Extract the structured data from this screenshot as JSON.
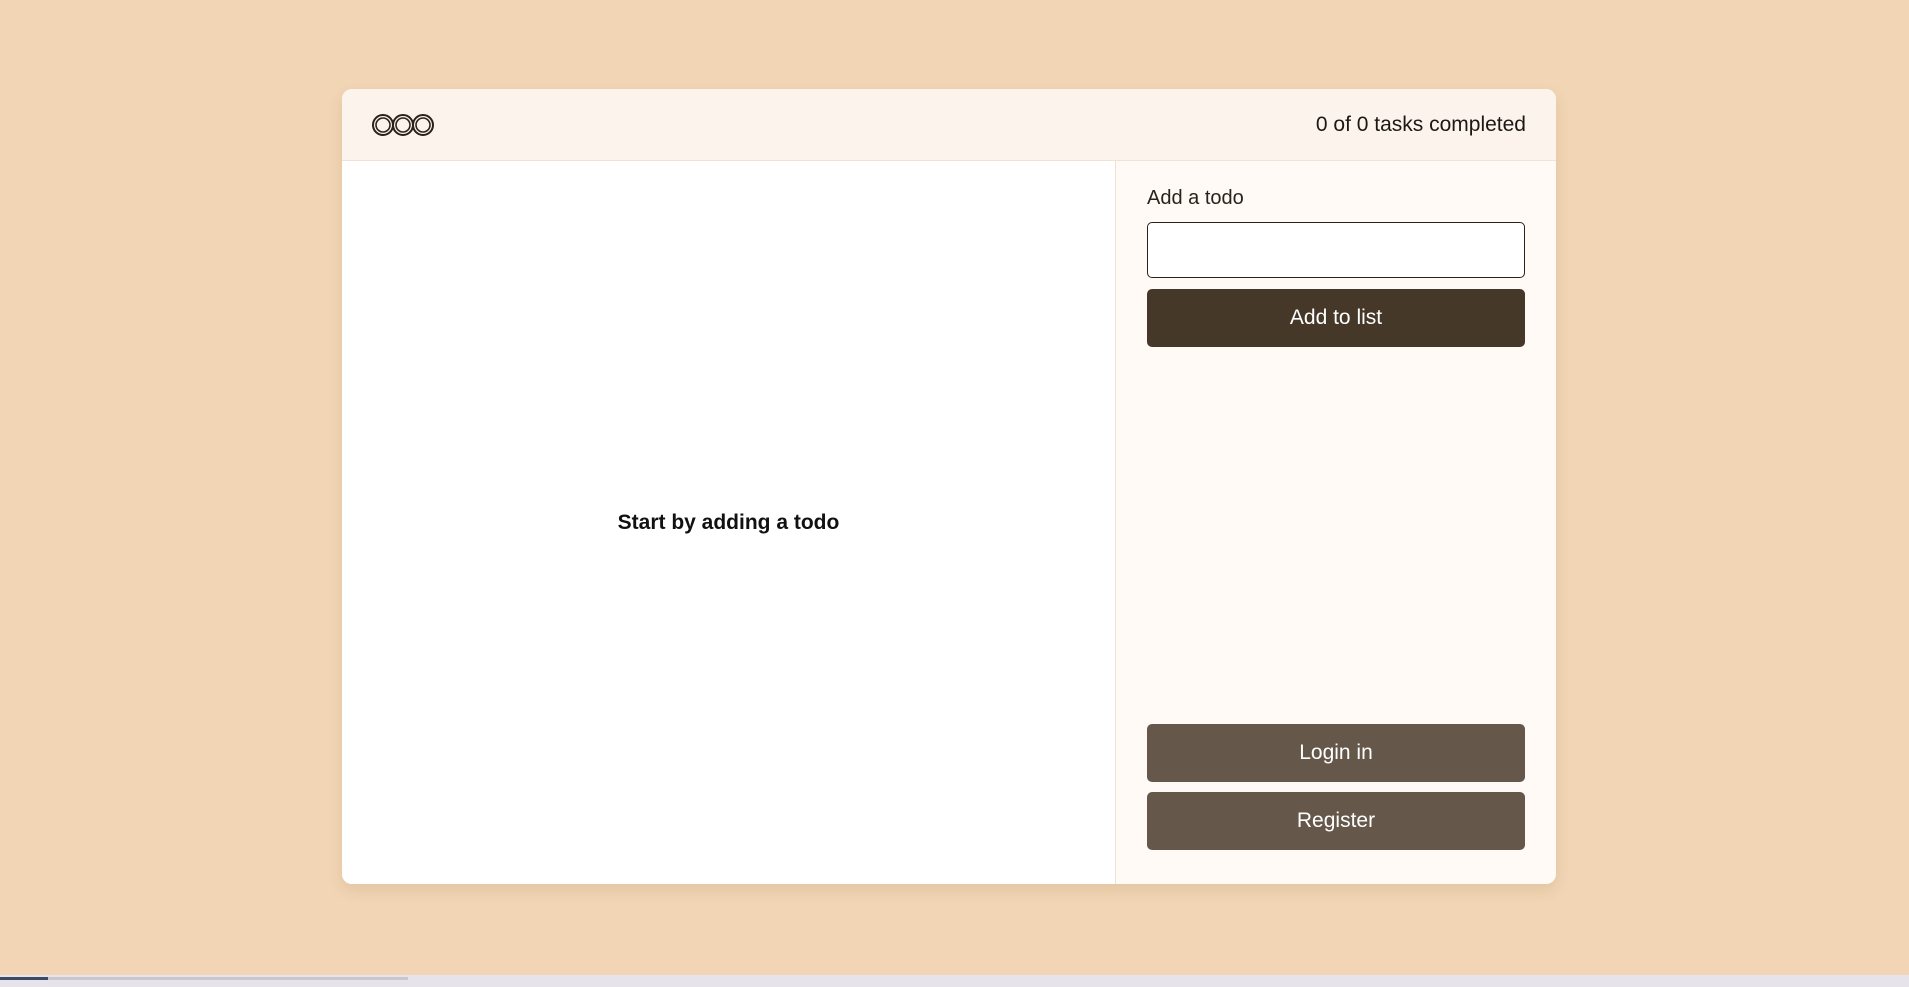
{
  "header": {
    "logo_icon": "three-rings-logo-icon",
    "progress": "0 of 0 tasks completed"
  },
  "list": {
    "empty_message": "Start by adding a todo"
  },
  "form": {
    "label": "Add a todo",
    "input_value": "",
    "input_placeholder": "",
    "add_button": "Add to list"
  },
  "auth": {
    "login_button": "Login in",
    "register_button": "Register"
  },
  "colors": {
    "page_bg": "#f1d5b4",
    "primary_button": "#463828",
    "secondary_button": "#65584b"
  }
}
